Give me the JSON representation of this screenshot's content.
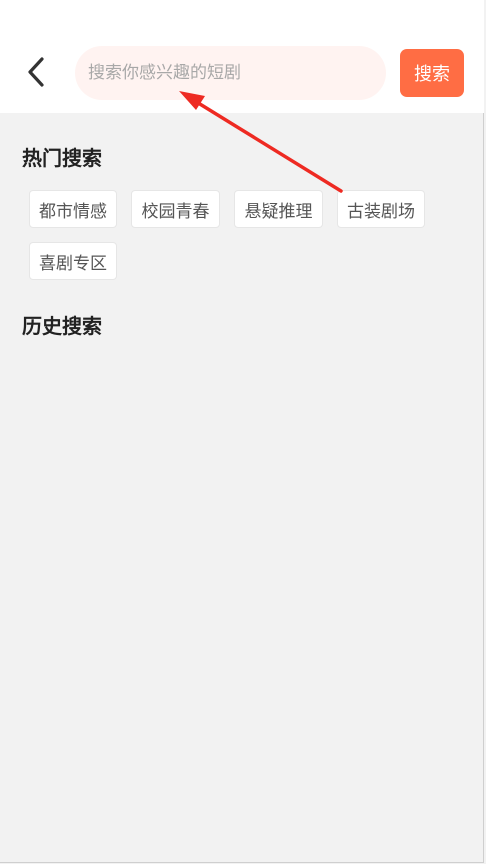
{
  "header": {
    "search": {
      "placeholder": "搜索你感兴趣的短剧",
      "value": ""
    },
    "search_button_label": "搜索"
  },
  "hot_search": {
    "title": "热门搜索",
    "tags": [
      {
        "label": "都市情感"
      },
      {
        "label": "校园青春"
      },
      {
        "label": "悬疑推理"
      },
      {
        "label": "古装剧场"
      },
      {
        "label": "喜剧专区"
      }
    ]
  },
  "history_search": {
    "title": "历史搜索"
  },
  "annotation": {
    "arrow_color": "#ee2a22"
  },
  "icons": {
    "back": "chevron-left-icon"
  }
}
